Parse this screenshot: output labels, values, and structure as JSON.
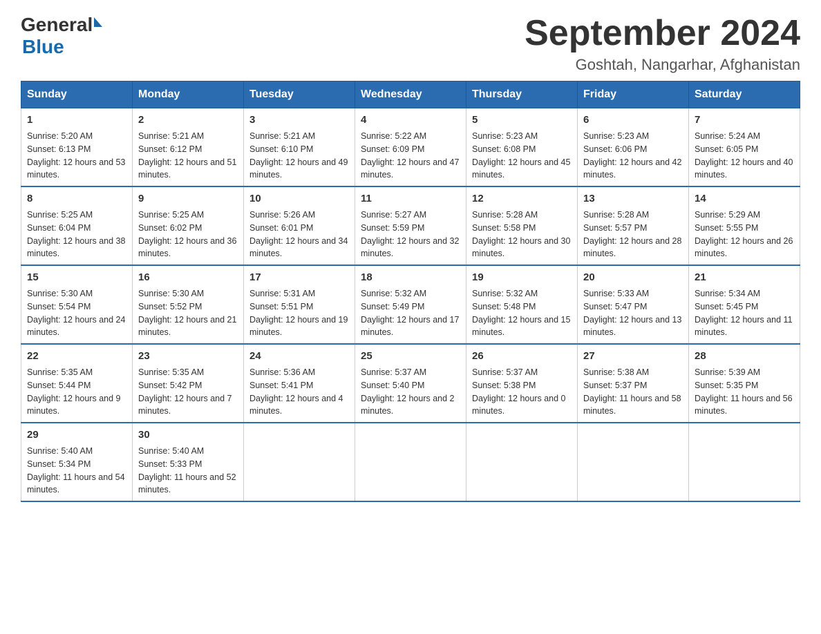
{
  "logo": {
    "general": "General",
    "blue": "Blue"
  },
  "title": "September 2024",
  "subtitle": "Goshtah, Nangarhar, Afghanistan",
  "days_of_week": [
    "Sunday",
    "Monday",
    "Tuesday",
    "Wednesday",
    "Thursday",
    "Friday",
    "Saturday"
  ],
  "weeks": [
    [
      {
        "day": 1,
        "sunrise": "5:20 AM",
        "sunset": "6:13 PM",
        "daylight": "12 hours and 53 minutes."
      },
      {
        "day": 2,
        "sunrise": "5:21 AM",
        "sunset": "6:12 PM",
        "daylight": "12 hours and 51 minutes."
      },
      {
        "day": 3,
        "sunrise": "5:21 AM",
        "sunset": "6:10 PM",
        "daylight": "12 hours and 49 minutes."
      },
      {
        "day": 4,
        "sunrise": "5:22 AM",
        "sunset": "6:09 PM",
        "daylight": "12 hours and 47 minutes."
      },
      {
        "day": 5,
        "sunrise": "5:23 AM",
        "sunset": "6:08 PM",
        "daylight": "12 hours and 45 minutes."
      },
      {
        "day": 6,
        "sunrise": "5:23 AM",
        "sunset": "6:06 PM",
        "daylight": "12 hours and 42 minutes."
      },
      {
        "day": 7,
        "sunrise": "5:24 AM",
        "sunset": "6:05 PM",
        "daylight": "12 hours and 40 minutes."
      }
    ],
    [
      {
        "day": 8,
        "sunrise": "5:25 AM",
        "sunset": "6:04 PM",
        "daylight": "12 hours and 38 minutes."
      },
      {
        "day": 9,
        "sunrise": "5:25 AM",
        "sunset": "6:02 PM",
        "daylight": "12 hours and 36 minutes."
      },
      {
        "day": 10,
        "sunrise": "5:26 AM",
        "sunset": "6:01 PM",
        "daylight": "12 hours and 34 minutes."
      },
      {
        "day": 11,
        "sunrise": "5:27 AM",
        "sunset": "5:59 PM",
        "daylight": "12 hours and 32 minutes."
      },
      {
        "day": 12,
        "sunrise": "5:28 AM",
        "sunset": "5:58 PM",
        "daylight": "12 hours and 30 minutes."
      },
      {
        "day": 13,
        "sunrise": "5:28 AM",
        "sunset": "5:57 PM",
        "daylight": "12 hours and 28 minutes."
      },
      {
        "day": 14,
        "sunrise": "5:29 AM",
        "sunset": "5:55 PM",
        "daylight": "12 hours and 26 minutes."
      }
    ],
    [
      {
        "day": 15,
        "sunrise": "5:30 AM",
        "sunset": "5:54 PM",
        "daylight": "12 hours and 24 minutes."
      },
      {
        "day": 16,
        "sunrise": "5:30 AM",
        "sunset": "5:52 PM",
        "daylight": "12 hours and 21 minutes."
      },
      {
        "day": 17,
        "sunrise": "5:31 AM",
        "sunset": "5:51 PM",
        "daylight": "12 hours and 19 minutes."
      },
      {
        "day": 18,
        "sunrise": "5:32 AM",
        "sunset": "5:49 PM",
        "daylight": "12 hours and 17 minutes."
      },
      {
        "day": 19,
        "sunrise": "5:32 AM",
        "sunset": "5:48 PM",
        "daylight": "12 hours and 15 minutes."
      },
      {
        "day": 20,
        "sunrise": "5:33 AM",
        "sunset": "5:47 PM",
        "daylight": "12 hours and 13 minutes."
      },
      {
        "day": 21,
        "sunrise": "5:34 AM",
        "sunset": "5:45 PM",
        "daylight": "12 hours and 11 minutes."
      }
    ],
    [
      {
        "day": 22,
        "sunrise": "5:35 AM",
        "sunset": "5:44 PM",
        "daylight": "12 hours and 9 minutes."
      },
      {
        "day": 23,
        "sunrise": "5:35 AM",
        "sunset": "5:42 PM",
        "daylight": "12 hours and 7 minutes."
      },
      {
        "day": 24,
        "sunrise": "5:36 AM",
        "sunset": "5:41 PM",
        "daylight": "12 hours and 4 minutes."
      },
      {
        "day": 25,
        "sunrise": "5:37 AM",
        "sunset": "5:40 PM",
        "daylight": "12 hours and 2 minutes."
      },
      {
        "day": 26,
        "sunrise": "5:37 AM",
        "sunset": "5:38 PM",
        "daylight": "12 hours and 0 minutes."
      },
      {
        "day": 27,
        "sunrise": "5:38 AM",
        "sunset": "5:37 PM",
        "daylight": "11 hours and 58 minutes."
      },
      {
        "day": 28,
        "sunrise": "5:39 AM",
        "sunset": "5:35 PM",
        "daylight": "11 hours and 56 minutes."
      }
    ],
    [
      {
        "day": 29,
        "sunrise": "5:40 AM",
        "sunset": "5:34 PM",
        "daylight": "11 hours and 54 minutes."
      },
      {
        "day": 30,
        "sunrise": "5:40 AM",
        "sunset": "5:33 PM",
        "daylight": "11 hours and 52 minutes."
      },
      null,
      null,
      null,
      null,
      null
    ]
  ]
}
